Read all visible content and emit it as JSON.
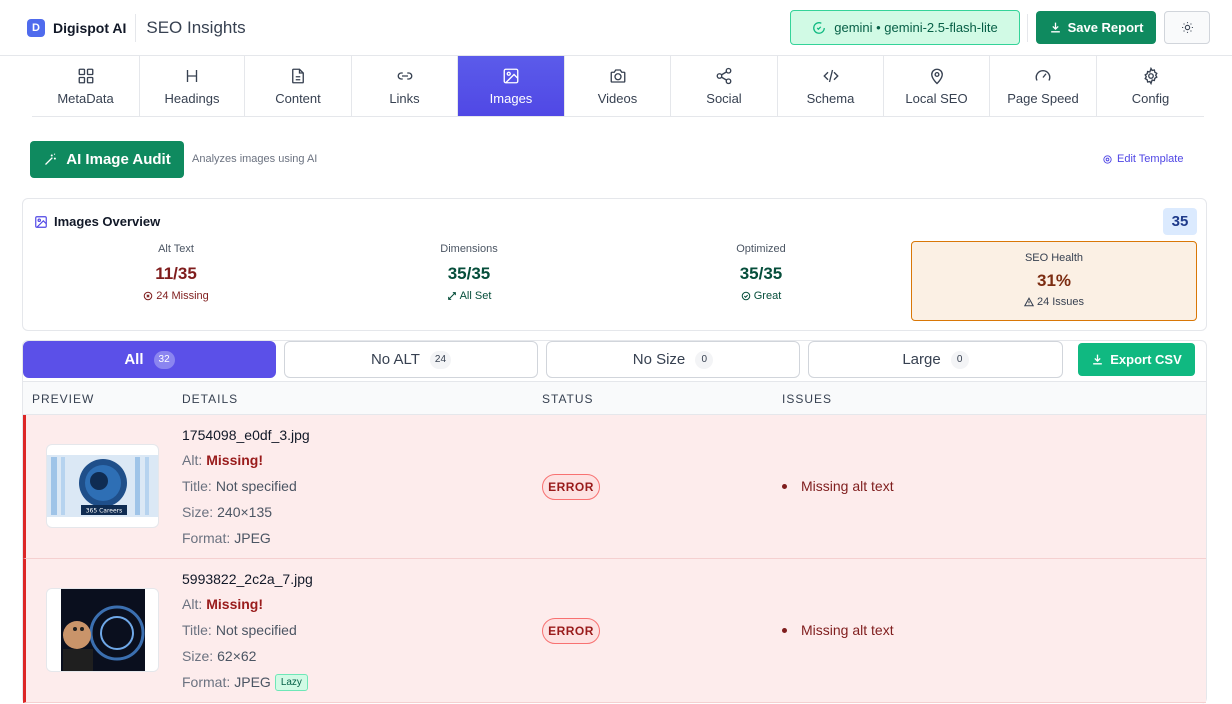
{
  "header": {
    "logo_letter": "D",
    "brand": "Digispot AI",
    "title": "SEO Insights",
    "model_badge": "gemini • gemini-2.5-flash-lite",
    "save_label": "Save Report"
  },
  "tabs": [
    {
      "label": "MetaData",
      "icon": "grid-icon"
    },
    {
      "label": "Headings",
      "icon": "heading-icon"
    },
    {
      "label": "Content",
      "icon": "document-icon"
    },
    {
      "label": "Links",
      "icon": "link-icon"
    },
    {
      "label": "Images",
      "icon": "image-icon",
      "active": true
    },
    {
      "label": "Videos",
      "icon": "camera-icon"
    },
    {
      "label": "Social",
      "icon": "share-icon"
    },
    {
      "label": "Schema",
      "icon": "code-icon"
    },
    {
      "label": "Local SEO",
      "icon": "map-pin-icon"
    },
    {
      "label": "Page Speed",
      "icon": "gauge-icon"
    },
    {
      "label": "Config",
      "icon": "gear-icon"
    }
  ],
  "audit": {
    "button_label": "AI Image Audit",
    "description": "Analyzes images using AI",
    "edit_template": "Edit Template"
  },
  "overview": {
    "title": "Images Overview",
    "total": "35",
    "alt_text": {
      "label": "Alt Text",
      "value": "11/35",
      "sub": "24 Missing"
    },
    "dimensions": {
      "label": "Dimensions",
      "value": "35/35",
      "sub": "All Set"
    },
    "optimized": {
      "label": "Optimized",
      "value": "35/35",
      "sub": "Great"
    },
    "seo_health": {
      "label": "SEO Health",
      "value": "31%",
      "sub": "24 Issues"
    }
  },
  "filters": {
    "all": {
      "label": "All",
      "count": "32"
    },
    "no_alt": {
      "label": "No ALT",
      "count": "24"
    },
    "no_size": {
      "label": "No Size",
      "count": "0"
    },
    "large": {
      "label": "Large",
      "count": "0"
    },
    "export_label": "Export CSV"
  },
  "table": {
    "headers": {
      "preview": "PREVIEW",
      "details": "DETAILS",
      "status": "STATUS",
      "issues": "ISSUES"
    },
    "labels": {
      "alt": "Alt:",
      "title": "Title:",
      "size": "Size:",
      "format": "Format:"
    },
    "rows": [
      {
        "filename": "1754098_e0df_3.jpg",
        "alt": "Missing!",
        "title": "Not specified",
        "size": "240×135",
        "format": "JPEG",
        "status": "ERROR",
        "issue": "Missing alt text",
        "thumb_caption": "365 Careers"
      },
      {
        "filename": "5993822_2c2a_7.jpg",
        "alt": "Missing!",
        "title": "Not specified",
        "size": "62×62",
        "format": "JPEG",
        "lazy": "Lazy",
        "status": "ERROR",
        "issue": "Missing alt text"
      }
    ]
  },
  "colors": {
    "accent": "#5b50e8",
    "brand_green": "#0f8a5f",
    "error": "#dc2626"
  }
}
